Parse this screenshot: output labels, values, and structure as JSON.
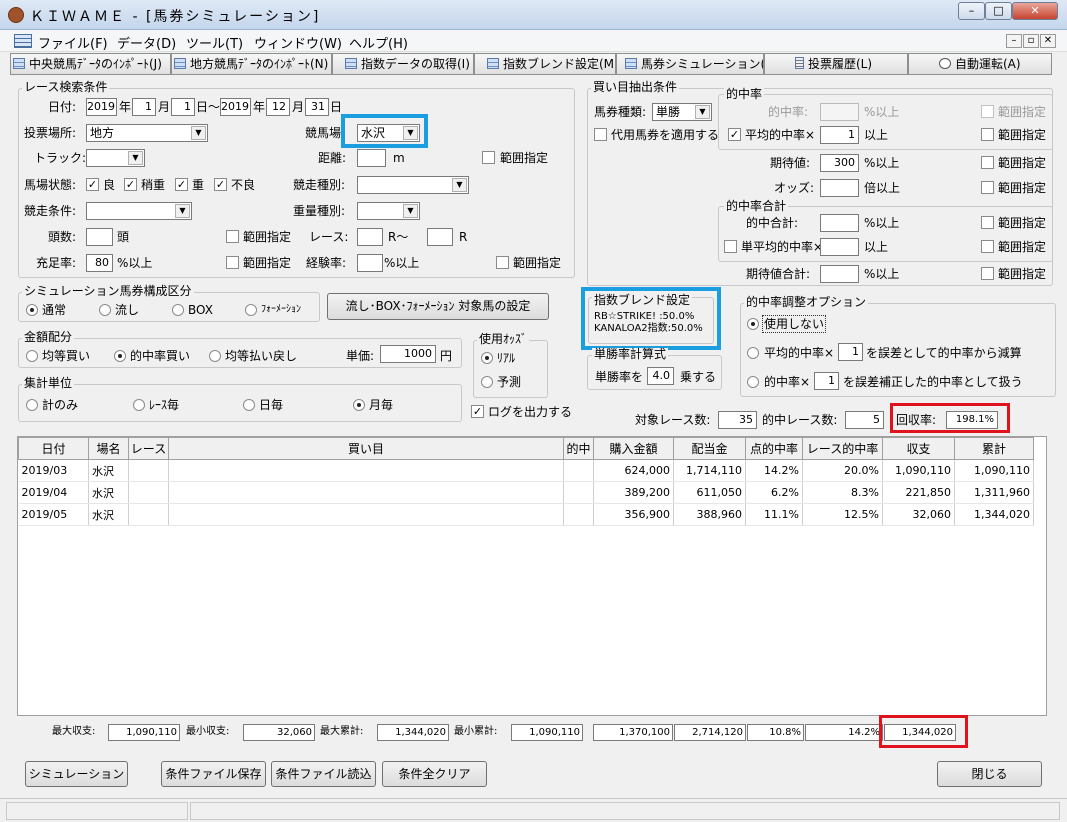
{
  "window": {
    "title": "ＫＩＷＡＭＥ - [馬券シミュレーション]"
  },
  "menu": [
    "ファイル(F)",
    "データ(D)",
    "ツール(T)",
    "ウィンドウ(W)",
    "ヘルプ(H)"
  ],
  "toolbar": {
    "central": "中央競馬ﾃﾞｰﾀのｲﾝﾎﾟｰﾄ(J)",
    "local": "地方競馬ﾃﾞｰﾀのｲﾝﾎﾟｰﾄ(N)",
    "fetch": "指数データの取得(I)",
    "blend": "指数ブレンド設定(M)",
    "sim": "馬券シミュレーション(B)",
    "history": "投票履歴(L)",
    "auto": "自動運転(A)"
  },
  "race": {
    "legend": "レース検索条件",
    "date_label": "日付:",
    "date_from": {
      "year": "2019",
      "month": "1",
      "day": "1"
    },
    "date_to": {
      "year": "2019",
      "month": "12",
      "day": "31"
    },
    "u_year": "年",
    "u_month": "月",
    "u_day": "日",
    "u_tilde": "日～",
    "u_day2": "日",
    "venue_label": "投票場所:",
    "venue": "地方",
    "track_name_label": "競馬場",
    "track_name": "水沢",
    "track_label": "トラック:",
    "distance_label": "距離:",
    "distance_unit": "m",
    "range": "範囲指定",
    "condition_label": "馬場状態:",
    "conditions": [
      "良",
      "稍重",
      "重",
      "不良"
    ],
    "race_type_label": "競走種別:",
    "race_cond_label": "競走条件:",
    "weight_type_label": "重量種別:",
    "head_label": "頭数:",
    "head_unit": "頭",
    "race_label": "レース:",
    "race_r1": "R～",
    "race_r2": "R",
    "fill_label": "充足率:",
    "fill_value": "80",
    "fill_unit": "%以上",
    "exp_label": "経験率:",
    "exp_unit": "%以上"
  },
  "bet": {
    "legend": "買い目抽出条件",
    "type_label": "馬券種類:",
    "type": "単勝",
    "substitute": "代用馬券を適用する",
    "hit": {
      "legend": "的中率",
      "rate_label": "的中率:",
      "rate_unit": "%以上",
      "avg_label": "平均的中率×",
      "avg_value": "1",
      "avg_unit": "以上",
      "range": "範囲指定"
    },
    "ev_label": "期待値:",
    "ev_value": "300",
    "ev_unit": "%以上",
    "odds_label": "オッズ:",
    "odds_unit": "倍以上",
    "total": {
      "legend": "的中率合計",
      "sum_label": "的中合計:",
      "sum_unit": "%以上",
      "avg_label": "単平均的中率×",
      "avg_unit": "以上"
    },
    "ev_sum_label": "期待値合計:",
    "ev_sum_unit": "%以上"
  },
  "sim_comp": {
    "legend": "シミュレーション馬券構成区分",
    "options": [
      "通常",
      "流し",
      "BOX",
      "ﾌｫｰﾒｰｼｮﾝ"
    ],
    "setting_button": "流し･BOX･ﾌｫｰﾒｰｼｮﾝ 対象馬の設定"
  },
  "blend": {
    "legend": "指数ブレンド設定",
    "line1": "RB☆STRIKE! :50.0%",
    "line2": "KANALOA2指数:50.0%"
  },
  "adjust": {
    "legend": "的中率調整オプション",
    "opt1": "使用しない",
    "opt2a": "平均的中率×",
    "opt2_val": "1",
    "opt2b": "を誤差として的中率から減算",
    "opt3a": "的中率×",
    "opt3_val": "1",
    "opt3b": "を誤差補正した的中率として扱う"
  },
  "amount": {
    "legend": "金額配分",
    "options": [
      "均等買い",
      "的中率買い",
      "均等払い戻し"
    ],
    "unit_label": "単価:",
    "unit_value": "1000",
    "unit_yen": "円"
  },
  "odds": {
    "legend": "使用ｵｯｽﾞ",
    "options": [
      "ﾘｱﾙ",
      "予測"
    ]
  },
  "win_calc": {
    "legend": "単勝率計算式",
    "label": "単勝率を",
    "value": "4.0",
    "unit": "乗する"
  },
  "aggregate": {
    "legend": "集計単位",
    "options": [
      "計のみ",
      "ﾚｰｽ毎",
      "日毎",
      "月毎"
    ],
    "log": "ログを出力する"
  },
  "stats": {
    "race_count_label": "対象レース数:",
    "race_count": "35",
    "hit_count_label": "的中レース数:",
    "hit_count": "5",
    "recovery_label": "回収率:",
    "recovery": "198.1%"
  },
  "table": {
    "headers": [
      "日付",
      "場名",
      "レース",
      "買い目",
      "的中",
      "購入金額",
      "配当金",
      "点的中率",
      "レース的中率",
      "収支",
      "累計"
    ],
    "rows": [
      [
        "2019/03",
        "水沢",
        "",
        "",
        "",
        "624,000",
        "1,714,110",
        "14.2%",
        "20.0%",
        "1,090,110",
        "1,090,110"
      ],
      [
        "2019/04",
        "水沢",
        "",
        "",
        "",
        "389,200",
        "611,050",
        "6.2%",
        "8.3%",
        "221,850",
        "1,311,960"
      ],
      [
        "2019/05",
        "水沢",
        "",
        "",
        "",
        "356,900",
        "388,960",
        "11.1%",
        "12.5%",
        "32,060",
        "1,344,020"
      ]
    ]
  },
  "summary": {
    "max_label": "最大収支:",
    "max": "1,090,110",
    "min_label": "最小収支:",
    "min": "32,060",
    "max_cum_label": "最大累計:",
    "max_cum": "1,344,020",
    "min_cum_label": "最小累計:",
    "min_cum": "1,090,110",
    "t_buy": "1,370,100",
    "t_pay": "2,714,120",
    "t_pt": "10.8%",
    "t_race": "14.2%",
    "t_total": "1,344,020"
  },
  "buttons": {
    "simulate": "シミュレーション",
    "save": "条件ファイル保存",
    "load": "条件ファイル読込",
    "clear": "条件全クリア",
    "close": "閉じる"
  }
}
